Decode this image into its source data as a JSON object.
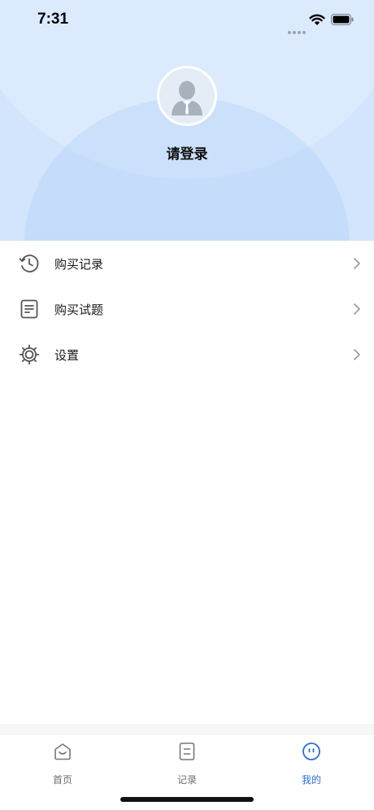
{
  "status_bar": {
    "time": "7:31"
  },
  "profile": {
    "login_prompt": "请登录"
  },
  "menu": {
    "items": [
      {
        "label": "购买记录",
        "icon": "history-icon"
      },
      {
        "label": "购买试题",
        "icon": "document-icon"
      },
      {
        "label": "设置",
        "icon": "gear-icon"
      }
    ]
  },
  "tabbar": {
    "tabs": [
      {
        "label": "首页",
        "icon": "home-icon",
        "active": false
      },
      {
        "label": "记录",
        "icon": "record-icon",
        "active": false
      },
      {
        "label": "我的",
        "icon": "profile-face-icon",
        "active": true
      }
    ]
  },
  "colors": {
    "header_bg": "#d3e5fd",
    "accent": "#2f6fd6",
    "icon_gray": "#555555"
  }
}
